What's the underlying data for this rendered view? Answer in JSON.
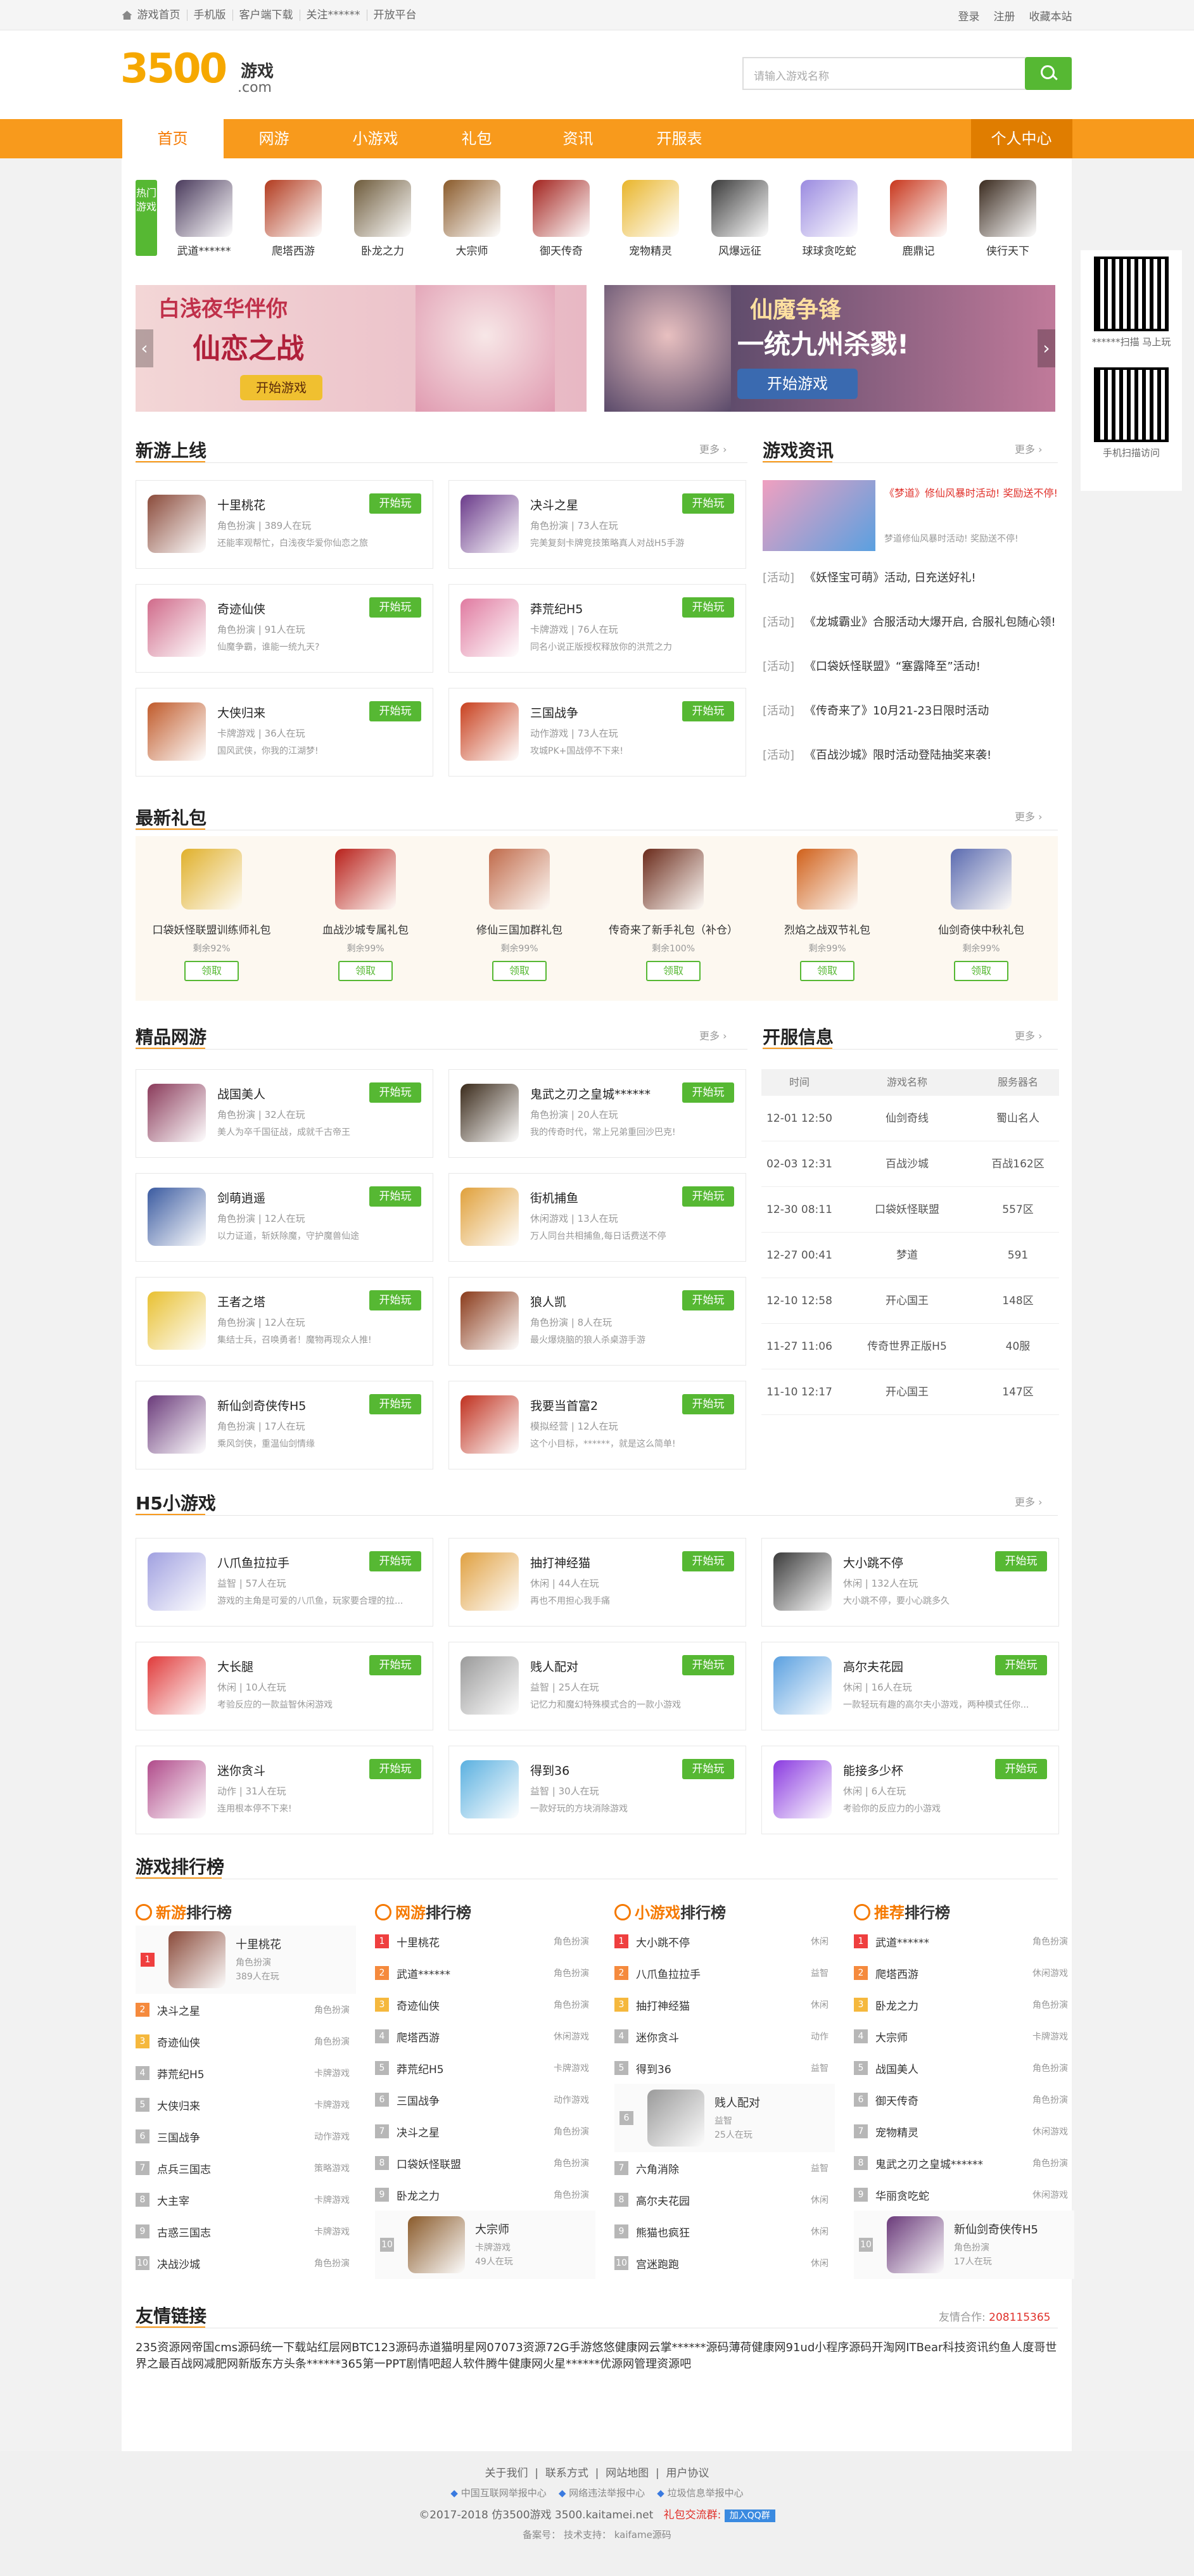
{
  "topbar": {
    "links": [
      "游戏首页",
      "手机版",
      "客户端下载",
      "关注******",
      "开放平台"
    ],
    "right": [
      "登录",
      "注册",
      "收藏本站"
    ]
  },
  "logo": {
    "num": "3500",
    "cn": "游戏",
    "com": ".com"
  },
  "search": {
    "placeholder": "请输入游戏名称"
  },
  "nav": {
    "items": [
      "首页",
      "网游",
      "小游戏",
      "礼包",
      "资讯",
      "开服表"
    ],
    "personal": "个人中心"
  },
  "hot": {
    "label": "热门游戏",
    "games": [
      {
        "name": "武道******",
        "color": "#4a3a5c"
      },
      {
        "name": "爬塔西游",
        "color": "#b23a1e"
      },
      {
        "name": "卧龙之力",
        "color": "#6d5a3a"
      },
      {
        "name": "大宗师",
        "color": "#8a5a2a"
      },
      {
        "name": "御天传奇",
        "color": "#a3231e"
      },
      {
        "name": "宠物精灵",
        "color": "#e9b52a"
      },
      {
        "name": "风爆远征",
        "color": "#3a3a3a"
      },
      {
        "name": "球球贪吃蛇",
        "color": "#9a8ae0"
      },
      {
        "name": "鹿鼎记",
        "color": "#c8361c"
      },
      {
        "name": "侠行天下",
        "color": "#3a2a1e"
      }
    ]
  },
  "banners": [
    {
      "t1": "白浅夜华伴你",
      "t2": "仙恋之战",
      "btn": "开始游戏"
    },
    {
      "t1": "仙魔争锋",
      "t2": "一统九州杀戮!",
      "btn": "开始游戏"
    }
  ],
  "qr": [
    {
      "cap": "******扫描 马上玩"
    },
    {
      "cap": "手机扫描访问"
    }
  ],
  "new_games": {
    "title": "新游上线",
    "more": "更多",
    "cards": [
      {
        "name": "十里桃花",
        "sub": "角色扮演 | 389人在玩",
        "desc": "还能率观帮忙，白浅夜华爱你仙恋之旅",
        "btn": "开始玩",
        "color": "#8a4a3a"
      },
      {
        "name": "决斗之星",
        "sub": "角色扮演 | 73人在玩",
        "desc": "完美复刻卡牌竞技策略真人对战H5手游",
        "btn": "开始玩",
        "color": "#6a3a8a"
      },
      {
        "name": "奇迹仙侠",
        "sub": "角色扮演 | 91人在玩",
        "desc": "仙魔争霸，谁能一统九天?",
        "btn": "开始玩",
        "color": "#d06a8a"
      },
      {
        "name": "莽荒纪H5",
        "sub": "卡牌游戏 | 76人在玩",
        "desc": "同名小说正版授权释放你的洪荒之力",
        "btn": "开始玩",
        "color": "#e07aa0"
      },
      {
        "name": "大侠归来",
        "sub": "卡牌游戏 | 36人在玩",
        "desc": "国风武侠，你我的江湖梦!",
        "btn": "开始玩",
        "color": "#c05a2a"
      },
      {
        "name": "三国战争",
        "sub": "动作游戏 | 73人在玩",
        "desc": "攻城PK+国战停不下来!",
        "btn": "开始玩",
        "color": "#c8401e"
      }
    ]
  },
  "news": {
    "title": "游戏资讯",
    "more": "更多",
    "top": {
      "title": "《梦道》修仙风暴时活动! 奖励送不停!",
      "desc": "梦道修仙风暴时活动! 奖励送不停!"
    },
    "items": [
      {
        "tag": "[活动]",
        "text": "《妖怪宝可萌》活动, 日充送好礼!"
      },
      {
        "tag": "[活动]",
        "text": "《龙城霸业》合服活动大爆开启, 合服礼包随心领!"
      },
      {
        "tag": "[活动]",
        "text": "《口袋妖怪联盟》“塞露降至”活动!"
      },
      {
        "tag": "[活动]",
        "text": "《传奇来了》10月21-23日限时活动"
      },
      {
        "tag": "[活动]",
        "text": "《百战沙城》限时活动登陆抽奖来袭!"
      }
    ]
  },
  "gifts": {
    "title": "最新礼包",
    "more": "更多",
    "items": [
      {
        "name": "口袋妖怪联盟训练师礼包",
        "remain": "剩余92%",
        "btn": "领取",
        "color": "#e0b02a"
      },
      {
        "name": "血战沙城专属礼包",
        "remain": "剩余99%",
        "btn": "领取",
        "color": "#b8201a"
      },
      {
        "name": "修仙三国加群礼包",
        "remain": "剩余99%",
        "btn": "领取",
        "color": "#c06a4a"
      },
      {
        "name": "传奇来了新手礼包（补仓）",
        "remain": "剩余100%",
        "btn": "领取",
        "color": "#6a2a1a"
      },
      {
        "name": "烈焰之战双节礼包",
        "remain": "剩余99%",
        "btn": "领取",
        "color": "#d0601a"
      },
      {
        "name": "仙剑奇侠中秋礼包",
        "remain": "剩余99%",
        "btn": "领取",
        "color": "#5a6ab0"
      }
    ]
  },
  "boutique": {
    "title": "精品网游",
    "more": "更多",
    "cards": [
      {
        "name": "战国美人",
        "sub": "角色扮演 | 32人在玩",
        "desc": "美人为卒千国征战，成就千古帝王",
        "btn": "开始玩",
        "color": "#8a3a5a"
      },
      {
        "name": "鬼武之刃之皇城******",
        "sub": "角色扮演 | 20人在玩",
        "desc": "我的传奇时代，常上兄弟重回沙巴克!",
        "btn": "开始玩",
        "color": "#3a2a1a"
      },
      {
        "name": "剑萌逍遥",
        "sub": "角色扮演 | 12人在玩",
        "desc": "以力证道，斩妖除魔，守护魔兽仙途",
        "btn": "开始玩",
        "color": "#3a5aa0"
      },
      {
        "name": "街机捕鱼",
        "sub": "休闲游戏 | 13人在玩",
        "desc": "万人同台共相捕鱼,每日话费送不停",
        "btn": "开始玩",
        "color": "#e0a03a"
      },
      {
        "name": "王者之塔",
        "sub": "角色扮演 | 12人在玩",
        "desc": "集结士兵，召唤勇者！魔物再现众人推!",
        "btn": "开始玩",
        "color": "#e8c030"
      },
      {
        "name": "狼人凯",
        "sub": "角色扮演 | 8人在玩",
        "desc": "最火爆烧脑的狼人杀桌游手游",
        "btn": "开始玩",
        "color": "#8a3a1a"
      },
      {
        "name": "新仙剑奇侠传H5",
        "sub": "角色扮演 | 17人在玩",
        "desc": "乘风剑侠，重温仙剑情缘",
        "btn": "开始玩",
        "color": "#6a3a7a"
      },
      {
        "name": "我要当首富2",
        "sub": "模拟经营 | 12人在玩",
        "desc": "这个小目标，******，就是这么简单!",
        "btn": "开始玩",
        "color": "#c0301e"
      }
    ]
  },
  "servers": {
    "title": "开服信息",
    "more": "更多",
    "headers": [
      "时间",
      "游戏名称",
      "服务器名"
    ],
    "rows": [
      [
        "12-01 12:50",
        "仙剑奇线",
        "蜀山名人"
      ],
      [
        "02-03 12:31",
        "百战沙城",
        "百战162区"
      ],
      [
        "12-30 08:11",
        "口袋妖怪联盟",
        "557区"
      ],
      [
        "12-27 00:41",
        "梦道",
        "591"
      ],
      [
        "12-10 12:58",
        "开心国王",
        "148区"
      ],
      [
        "11-27 11:06",
        "传奇世界正版H5",
        "40服"
      ],
      [
        "11-10 12:17",
        "开心国王",
        "147区"
      ]
    ]
  },
  "h5": {
    "title": "H5小游戏",
    "more": "更多",
    "cards": [
      {
        "name": "八爪鱼拉拉手",
        "sub": "益智 | 57人在玩",
        "desc": "游戏的主角是可爱的八爪鱼，玩家要合理的拉...",
        "btn": "开始玩",
        "color": "#a0a0e0"
      },
      {
        "name": "抽打神经猫",
        "sub": "休闲 | 44人在玩",
        "desc": "再也不用担心我手痛",
        "btn": "开始玩",
        "color": "#e0a040"
      },
      {
        "name": "大小跳不停",
        "sub": "休闲 | 132人在玩",
        "desc": "大小跳不停，要小心跳多久",
        "btn": "开始玩",
        "color": "#3a3a3a"
      },
      {
        "name": "大长腿",
        "sub": "休闲 | 10人在玩",
        "desc": "考验反应的一款益智休闲游戏",
        "btn": "开始玩",
        "color": "#e03a3a"
      },
      {
        "name": "贱人配对",
        "sub": "益智 | 25人在玩",
        "desc": "记忆力和魔幻特殊模式合的一款小游戏",
        "btn": "开始玩",
        "color": "#9a9a9a"
      },
      {
        "name": "高尔夫花园",
        "sub": "休闲 | 16人在玩",
        "desc": "一款轻玩有趣的高尔夫小游戏，两种模式任你...",
        "btn": "开始玩",
        "color": "#5aa0e0"
      },
      {
        "name": "迷你贪斗",
        "sub": "动作 | 31人在玩",
        "desc": "连用根本停不下来!",
        "btn": "开始玩",
        "color": "#b04a8a"
      },
      {
        "name": "得到36",
        "sub": "益智 | 30人在玩",
        "desc": "一款好玩的方块消除游戏",
        "btn": "开始玩",
        "color": "#5ab0e0"
      },
      {
        "name": "能接多少杯",
        "sub": "休闲 | 6人在玩",
        "desc": "考验你的反应力的小游戏",
        "btn": "开始玩",
        "color": "#8a3ae0"
      }
    ]
  },
  "ranking": {
    "title": "游戏排行榜",
    "lists": [
      {
        "hl": "新游",
        "rest": "排行榜",
        "top": {
          "name": "十里桃花",
          "cat": "角色扮演",
          "play": "389人在玩",
          "color": "#8a4a3a"
        },
        "items": [
          [
            "决斗之星",
            "角色扮演"
          ],
          [
            "奇迹仙侠",
            "角色扮演"
          ],
          [
            "莽荒纪H5",
            "卡牌游戏"
          ],
          [
            "大侠归来",
            "卡牌游戏"
          ],
          [
            "三国战争",
            "动作游戏"
          ],
          [
            "点兵三国志",
            "策略游戏"
          ],
          [
            "大主宰",
            "卡牌游戏"
          ],
          [
            "古惑三国志",
            "卡牌游戏"
          ],
          [
            "决战沙城",
            "角色扮演"
          ]
        ]
      },
      {
        "hl": "网游",
        "rest": "排行榜",
        "items": [
          [
            "十里桃花",
            "角色扮演"
          ],
          [
            "武道******",
            "角色扮演"
          ],
          [
            "奇迹仙侠",
            "角色扮演"
          ],
          [
            "爬塔西游",
            "休闲游戏"
          ],
          [
            "莽荒纪H5",
            "卡牌游戏"
          ],
          [
            "三国战争",
            "动作游戏"
          ],
          [
            "决斗之星",
            "角色扮演"
          ],
          [
            "口袋妖怪联盟",
            "角色扮演"
          ],
          [
            "卧龙之力",
            "角色扮演"
          ]
        ],
        "bottom": {
          "name": "大宗师",
          "cat": "卡牌游戏",
          "play": "49人在玩",
          "color": "#8a5a2a"
        }
      },
      {
        "hl": "小游戏",
        "rest": "排行榜",
        "items": [
          [
            "大小跳不停",
            "休闲"
          ],
          [
            "八爪鱼拉拉手",
            "益智"
          ],
          [
            "抽打神经猫",
            "休闲"
          ],
          [
            "迷你贪斗",
            "动作"
          ],
          [
            "得到36",
            "益智"
          ],
          [
            "六角消除",
            "益智"
          ],
          [
            "高尔夫花园",
            "休闲"
          ],
          [
            "熊猫也疯狂",
            "休闲"
          ],
          [
            "宫迷跑跑",
            "休闲"
          ]
        ],
        "mid": {
          "name": "贱人配对",
          "cat": "益智",
          "play": "25人在玩",
          "color": "#9a9a9a"
        }
      },
      {
        "hl": "推荐",
        "rest": "排行榜",
        "items": [
          [
            "武道******",
            "角色扮演"
          ],
          [
            "爬塔西游",
            "休闲游戏"
          ],
          [
            "卧龙之力",
            "角色扮演"
          ],
          [
            "大宗师",
            "卡牌游戏"
          ],
          [
            "战国美人",
            "角色扮演"
          ],
          [
            "御天传奇",
            "角色扮演"
          ],
          [
            "宠物精灵",
            "休闲游戏"
          ],
          [
            "鬼武之刃之皇城******",
            "角色扮演"
          ],
          [
            "华丽贪吃蛇",
            "休闲游戏"
          ]
        ],
        "bottom": {
          "name": "新仙剑奇侠传H5",
          "cat": "角色扮演",
          "play": "17人在玩",
          "color": "#6a3a7a"
        }
      }
    ]
  },
  "links": {
    "title": "友情链接",
    "contact_label": "友情合作:",
    "contact": "208115365",
    "items": [
      "235资源网",
      "帝国cms源码",
      "统一下载站",
      "红层网",
      "BTC123源码",
      "赤道猫",
      "明星网",
      "07073资源",
      "72G手游",
      "悠悠健康网",
      "云掌******源码",
      "薄荷健康网",
      "91ud小程序源码",
      "开淘网",
      "ITBear科技资讯",
      "约鱼人",
      "度哥世界之最",
      "百战网",
      "减肥网",
      "新版东方头条",
      "******365",
      "第一PPT",
      "剧情吧",
      "超人软件",
      "腾牛健康网",
      "火星******",
      "优源网",
      "管理资源吧"
    ]
  },
  "footer": {
    "links": [
      "关于我们",
      "联系方式",
      "网站地图",
      "用户协议"
    ],
    "badges": [
      "中国互联网举报中心",
      "网络违法举报中心",
      "垃圾信息举报中心"
    ],
    "copyright": "©2017-2018  仿3500游戏  3500.kaitamei.net",
    "qq_label": "礼包交流群:",
    "qq_btn": "加入QQ群",
    "icp": "备案号：   技术支持：   kaifame源码"
  }
}
